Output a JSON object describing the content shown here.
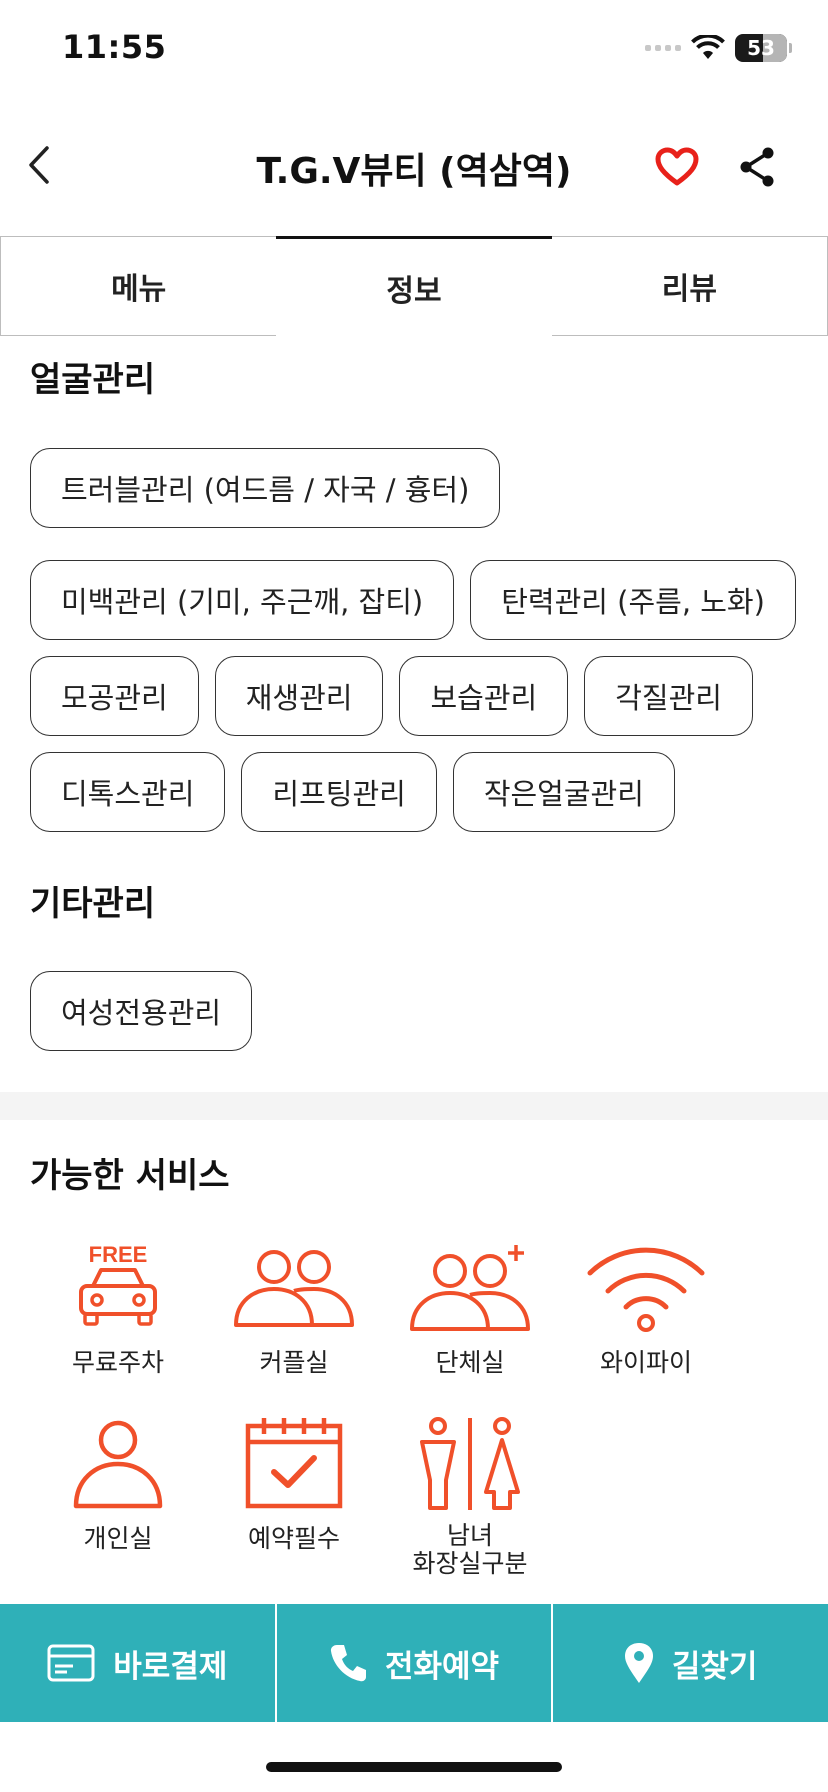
{
  "status_bar": {
    "time": "11:55",
    "battery": "53"
  },
  "header": {
    "title": "T.G.V뷰티 (역삼역)"
  },
  "tabs": [
    {
      "label": "메뉴"
    },
    {
      "label": "정보"
    },
    {
      "label": "리뷰"
    }
  ],
  "active_tab": "정보",
  "face_care": {
    "title": "얼굴관리",
    "chips": [
      "트러블관리 (여드름 / 자국 / 흉터)",
      "미백관리 (기미, 주근깨, 잡티)",
      "탄력관리 (주름, 노화)",
      "모공관리",
      "재생관리",
      "보습관리",
      "각질관리",
      "디톡스관리",
      "리프팅관리",
      "작은얼굴관리"
    ]
  },
  "other_care": {
    "title": "기타관리",
    "chips": [
      "여성전용관리"
    ]
  },
  "services": {
    "title": "가능한 서비스",
    "items": [
      {
        "label": "무료주차",
        "icon": "free-parking-icon",
        "badge": "FREE"
      },
      {
        "label": "커플실",
        "icon": "couple-room-icon"
      },
      {
        "label": "단체실",
        "icon": "group-room-icon"
      },
      {
        "label": "와이파이",
        "icon": "wifi-icon"
      },
      {
        "label": "개인실",
        "icon": "private-room-icon"
      },
      {
        "label": "예약필수",
        "icon": "reservation-required-icon"
      },
      {
        "label": "남녀\n화장실구분",
        "icon": "separate-restroom-icon"
      }
    ]
  },
  "bottom_bar": {
    "pay": "바로결제",
    "call": "전화예약",
    "directions": "길찾기"
  },
  "colors": {
    "accent": "#f0502a",
    "heart": "#e8211a",
    "bottom_bar": "#2fb0b8"
  }
}
